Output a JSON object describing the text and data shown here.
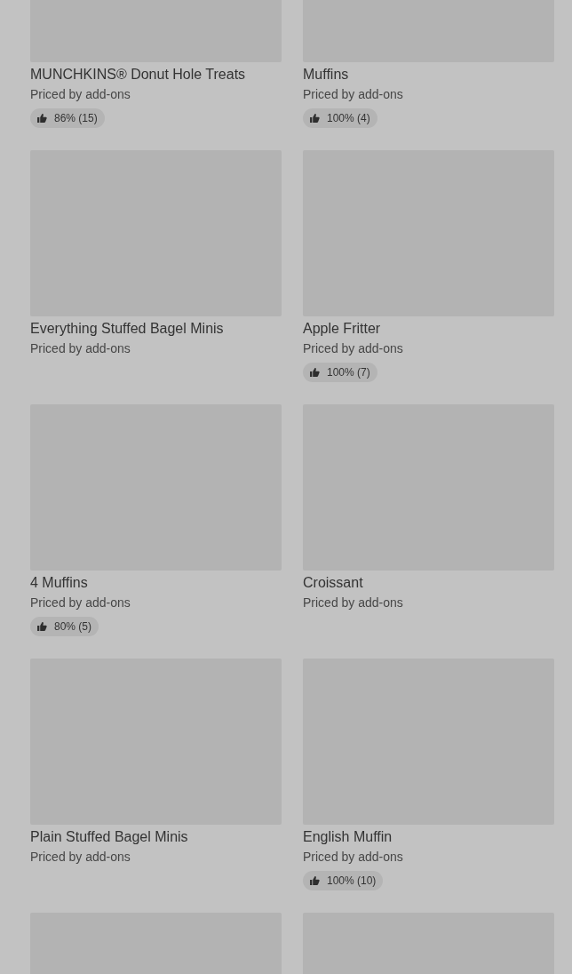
{
  "items": [
    {
      "kind": "product",
      "name": "MUNCHKINS® Donut Hole Treats",
      "price": "Priced by add-ons",
      "rating": "86% (15)"
    },
    {
      "kind": "product",
      "name": "Muffins",
      "price": "Priced by add-ons",
      "rating": "100% (4)"
    },
    {
      "kind": "product",
      "name": "Everything Stuffed Bagel Minis",
      "price": "Priced by add-ons"
    },
    {
      "kind": "product",
      "name": "Apple Fritter",
      "price": "Priced by add-ons",
      "rating": "100% (7)"
    },
    {
      "kind": "product",
      "name": "4 Muffins",
      "price": "Priced by add-ons",
      "rating": "80% (5)"
    },
    {
      "kind": "product",
      "name": "Croissant",
      "price": "Priced by add-ons"
    },
    {
      "kind": "product",
      "name": "Plain Stuffed Bagel Minis",
      "price": "Priced by add-ons"
    },
    {
      "kind": "product",
      "name": "English Muffin",
      "price": "Priced by add-ons",
      "rating": "100% (10)"
    },
    {
      "kind": "image_only"
    },
    {
      "kind": "image_only"
    }
  ]
}
